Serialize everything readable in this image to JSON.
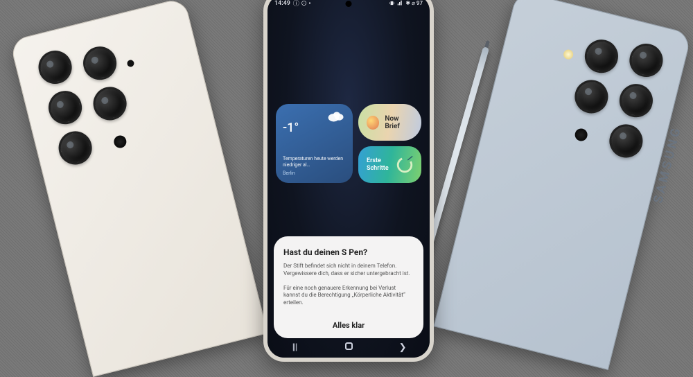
{
  "status": {
    "time": "14:49",
    "left_icons": "ⓘ ⊙ •",
    "right_icons": "✱ ⌀ 97"
  },
  "weather": {
    "temperature": "-1°",
    "description": "Temperaturen heute werden niedriger al…",
    "city": "Berlin"
  },
  "now_brief": {
    "label": "Now Brief"
  },
  "erste": {
    "line1": "Erste",
    "line2": "Schritte"
  },
  "dialog": {
    "title": "Hast du deinen S Pen?",
    "body1": "Der Stift befindet sich nicht in deinem Telefon. Vergewissere dich, dass er sicher untergebracht ist.",
    "body2": "Für eine noch genauere Erkennung bei Verlust kannst du die Berechtigung „Körperliche Aktivität“ erteilen.",
    "ok": "Alles klar"
  },
  "right_phone_brand": "SAMSUNG"
}
